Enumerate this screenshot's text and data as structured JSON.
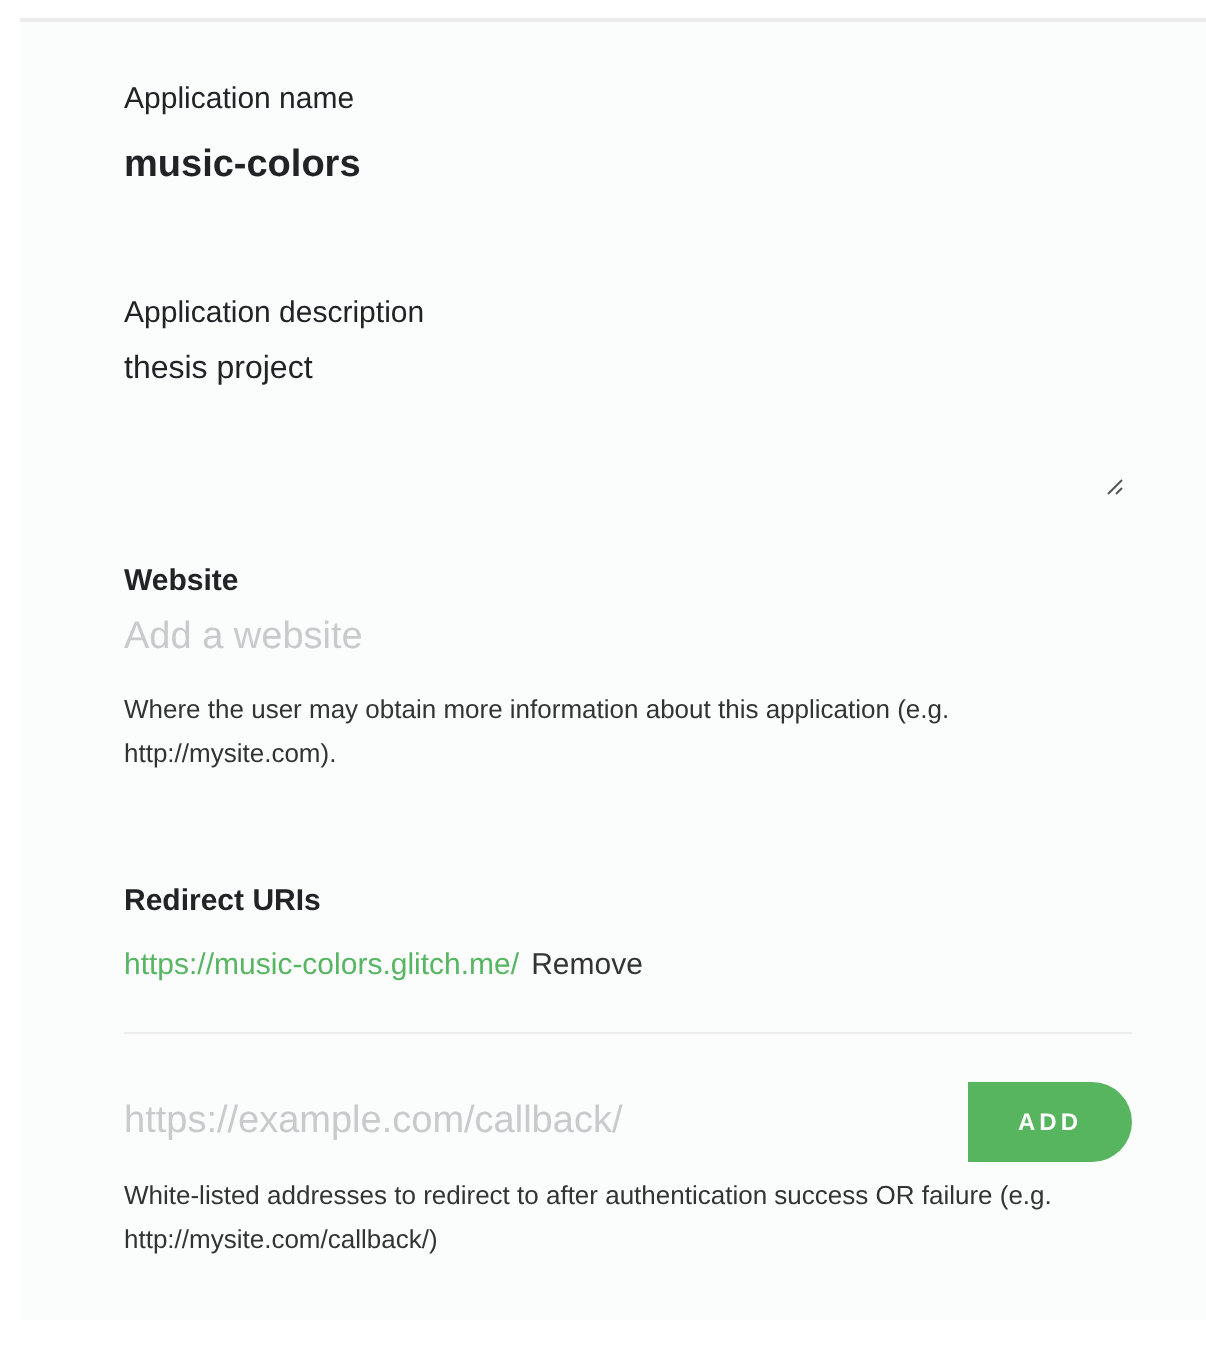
{
  "app_name": {
    "label": "Application name",
    "value": "music-colors"
  },
  "description": {
    "label": "Application description",
    "value": "thesis project"
  },
  "website": {
    "label": "Website",
    "placeholder": "Add a website",
    "help": "Where the user may obtain more information about this application (e.g. http://mysite.com)."
  },
  "redirect_uris": {
    "label": "Redirect URIs",
    "items": [
      {
        "uri": "https://music-colors.glitch.me/",
        "action": "Remove"
      }
    ],
    "placeholder": "https://example.com/callback/",
    "add_button": "ADD",
    "help": "White-listed addresses to redirect to after authentication success OR failure (e.g. http://mysite.com/callback/)"
  }
}
